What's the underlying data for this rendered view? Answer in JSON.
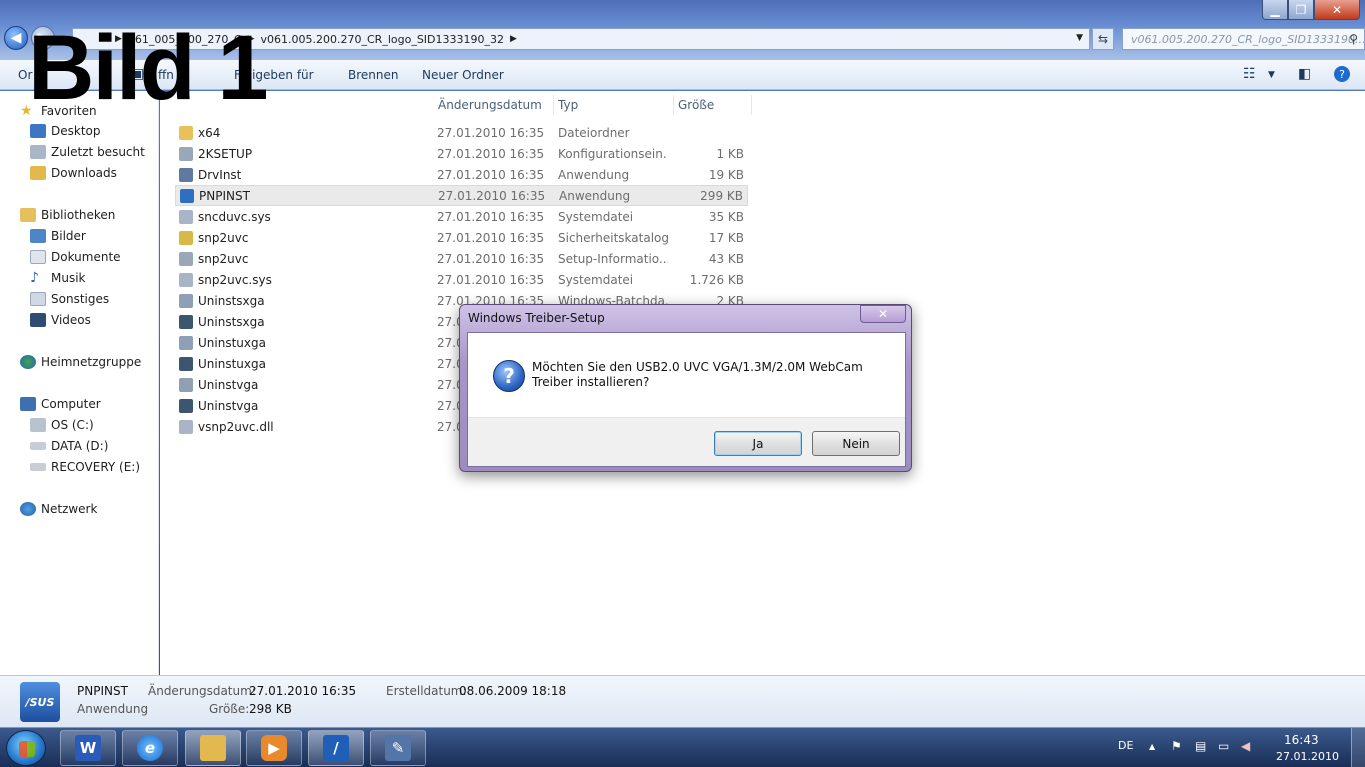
{
  "window": {
    "controls": {
      "minimize": "▁",
      "maximize": "❐",
      "close": "✕"
    }
  },
  "address_bar": {
    "segments": [
      "061_005_200_270_C",
      "v061.005.200.270_CR_logo_SID1333190_32"
    ],
    "search_placeholder": "v061.005.200.270_CR_logo_SID1333190..."
  },
  "toolbar": {
    "organize": "Or",
    "open": "ffn",
    "share": "Freigeben für",
    "burn": "Brennen",
    "new_folder": "Neuer Ordner"
  },
  "overlay_label": "Bild 1",
  "nav": {
    "favorites": "Favoriten",
    "desktop": "Desktop",
    "recent": "Zuletzt besucht",
    "downloads": "Downloads",
    "libraries": "Bibliotheken",
    "pictures": "Bilder",
    "documents": "Dokumente",
    "music": "Musik",
    "other": "Sonstiges",
    "videos": "Videos",
    "homegroup": "Heimnetzgruppe",
    "computer": "Computer",
    "drive_c": "OS (C:)",
    "drive_d": "DATA (D:)",
    "drive_e": "RECOVERY (E:)",
    "network": "Netzwerk"
  },
  "columns": {
    "date": "Änderungsdatum",
    "type": "Typ",
    "size": "Größe"
  },
  "files": [
    {
      "name": "x64",
      "date": "27.01.2010 16:35",
      "type": "Dateiordner",
      "size": "",
      "icon": "folder-icon",
      "color": "#e8c15a"
    },
    {
      "name": "2KSETUP",
      "date": "27.01.2010 16:35",
      "type": "Konfigurationsein...",
      "size": "1 KB",
      "icon": "config-file-icon",
      "color": "#9aa7b8"
    },
    {
      "name": "DrvInst",
      "date": "27.01.2010 16:35",
      "type": "Anwendung",
      "size": "19 KB",
      "icon": "application-icon",
      "color": "#5f7a9e"
    },
    {
      "name": "PNPINST",
      "date": "27.01.2010 16:35",
      "type": "Anwendung",
      "size": "299 KB",
      "icon": "asus-app-icon",
      "color": "#2f6fc2"
    },
    {
      "name": "sncduvc.sys",
      "date": "27.01.2010 16:35",
      "type": "Systemdatei",
      "size": "35 KB",
      "icon": "system-file-icon",
      "color": "#a9b5c6"
    },
    {
      "name": "snp2uvc",
      "date": "27.01.2010 16:35",
      "type": "Sicherheitskatalog",
      "size": "17 KB",
      "icon": "security-catalog-icon",
      "color": "#d9b84a"
    },
    {
      "name": "snp2uvc",
      "date": "27.01.2010 16:35",
      "type": "Setup-Informatio...",
      "size": "43 KB",
      "icon": "setup-info-icon",
      "color": "#9aa7b8"
    },
    {
      "name": "snp2uvc.sys",
      "date": "27.01.2010 16:35",
      "type": "Systemdatei",
      "size": "1.726 KB",
      "icon": "system-file-icon",
      "color": "#a9b5c6"
    },
    {
      "name": "Uninstsxga",
      "date": "27.01.2010 16:35",
      "type": "Windows-Batchda...",
      "size": "2 KB",
      "icon": "batch-file-icon",
      "color": "#8fa0b6"
    },
    {
      "name": "Uninstsxga",
      "date": "27.0",
      "type": "",
      "size": "",
      "icon": "application-icon",
      "color": "#3d5670"
    },
    {
      "name": "Uninstuxga",
      "date": "27.0",
      "type": "",
      "size": "",
      "icon": "batch-file-icon",
      "color": "#8fa0b6"
    },
    {
      "name": "Uninstuxga",
      "date": "27.0",
      "type": "",
      "size": "",
      "icon": "application-icon",
      "color": "#3d5670"
    },
    {
      "name": "Uninstvga",
      "date": "27.0",
      "type": "",
      "size": "",
      "icon": "batch-file-icon",
      "color": "#8fa0b6"
    },
    {
      "name": "Uninstvga",
      "date": "27.0",
      "type": "",
      "size": "",
      "icon": "application-icon",
      "color": "#3d5670"
    },
    {
      "name": "vsnp2uvc.dll",
      "date": "27.0",
      "type": "",
      "size": "",
      "icon": "dll-file-icon",
      "color": "#a9b5c6"
    }
  ],
  "details": {
    "name": "PNPINST",
    "type": "Anwendung",
    "modified_label": "Änderungsdatum:",
    "modified_value": "27.01.2010 16:35",
    "size_label": "Größe:",
    "size_value": "298 KB",
    "created_label": "Erstelldatum:",
    "created_value": "08.06.2009 18:18"
  },
  "dialog": {
    "title": "Windows Treiber-Setup",
    "message": "Möchten Sie den USB2.0 UVC VGA/1.3M/2.0M WebCam Treiber installieren?",
    "yes": "Ja",
    "no": "Nein"
  },
  "taskbar": {
    "language": "DE",
    "time": "16:43",
    "date": "27.01.2010"
  }
}
